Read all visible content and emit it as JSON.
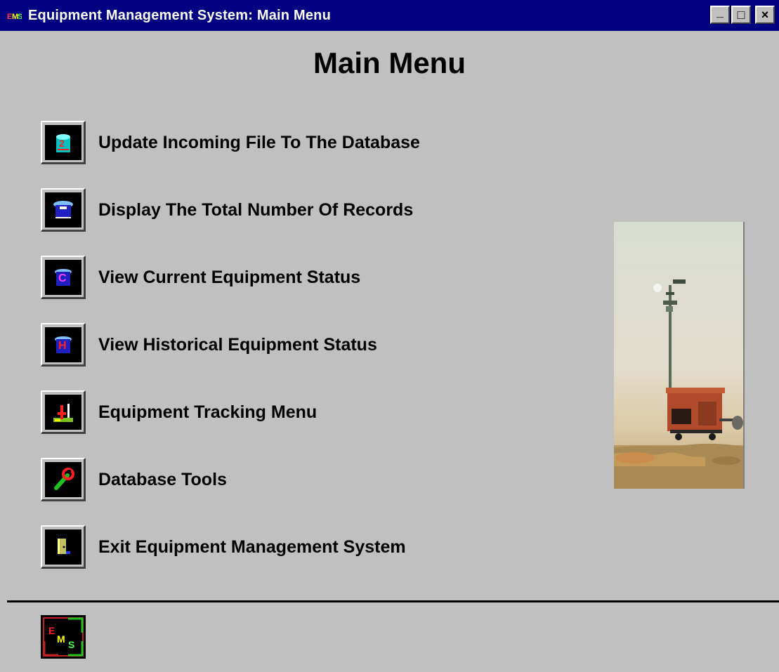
{
  "window": {
    "title": "Equipment Management System: Main Menu",
    "app_icon": "ems-app-icon",
    "controls": {
      "minimize": "_",
      "maximize": "□",
      "close": "×"
    }
  },
  "page": {
    "title": "Main Menu"
  },
  "menu": {
    "items": [
      {
        "label": "Update Incoming File To The Database",
        "icon": "database-update-icon"
      },
      {
        "label": "Display The Total Number Of Records",
        "icon": "database-count-icon"
      },
      {
        "label": "View Current Equipment Status",
        "icon": "current-status-icon"
      },
      {
        "label": "View Historical Equipment Status",
        "icon": "history-status-icon"
      },
      {
        "label": "Equipment Tracking Menu",
        "icon": "tracking-icon"
      },
      {
        "label": "Database Tools",
        "icon": "wrench-icon"
      },
      {
        "label": "Exit Equipment Management System",
        "icon": "exit-door-icon"
      }
    ]
  },
  "photo": {
    "subject": "equipment-photo"
  },
  "footer": {
    "logo": {
      "letters": [
        "E",
        "M",
        "S"
      ]
    }
  }
}
